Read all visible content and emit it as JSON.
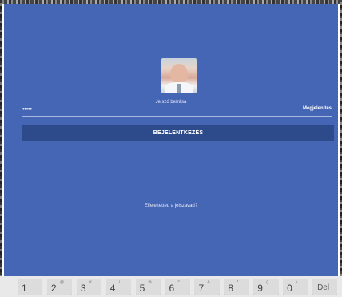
{
  "login": {
    "password_label": "Jelszó beírása",
    "password_mask": "•••••",
    "show_label": "Megjelenítés",
    "login_button": "BEJELENTKEZÉS",
    "forgot_link": "Elfelejtetted a jelszavad?"
  },
  "colors": {
    "background": "#4565b5",
    "button": "#2d4a8a"
  },
  "keyboard": {
    "keys": [
      {
        "main": "1",
        "sub": ""
      },
      {
        "main": "2",
        "sub": "@"
      },
      {
        "main": "3",
        "sub": "#"
      },
      {
        "main": "4",
        "sub": "/"
      },
      {
        "main": "5",
        "sub": "%"
      },
      {
        "main": "6",
        "sub": "^"
      },
      {
        "main": "7",
        "sub": "&"
      },
      {
        "main": "8",
        "sub": "*"
      },
      {
        "main": "9",
        "sub": "("
      },
      {
        "main": "0",
        "sub": ")"
      },
      {
        "main": "Del",
        "sub": ""
      }
    ]
  }
}
